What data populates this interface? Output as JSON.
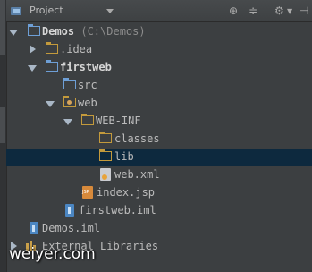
{
  "header": {
    "title": "Project",
    "tools": [
      "target-icon",
      "collapse-icon",
      "gear-icon",
      "hide-icon"
    ]
  },
  "tree": {
    "root_name": "Demos",
    "root_path": "(C:\\Demos)",
    "idea": ".idea",
    "firstweb": "firstweb",
    "src": "src",
    "web": "web",
    "webinf": "WEB-INF",
    "classes": "classes",
    "lib": "lib",
    "webxml": "web.xml",
    "indexjsp": "index.jsp",
    "firstweb_iml": "firstweb.iml",
    "demos_iml": "Demos.iml",
    "external_libraries": "External Libraries"
  },
  "selected_item": "lib",
  "watermark": "weiyer.com",
  "colors": {
    "background": "#3c3f41",
    "selection": "#0d293e",
    "folder": "#c39a3c",
    "source_folder": "#6e9fd6"
  }
}
